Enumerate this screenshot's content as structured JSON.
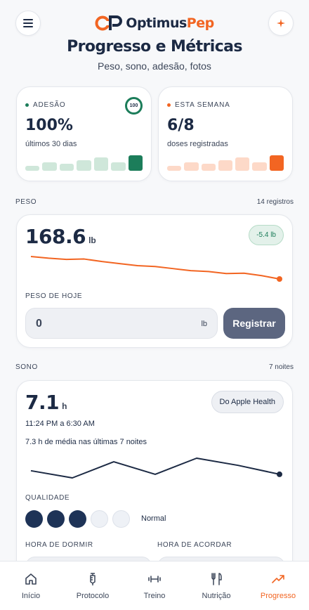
{
  "colors": {
    "accent": "#f26522",
    "navy": "#1c2a44",
    "green": "#1c7d5a"
  },
  "header": {
    "menu_icon": "hamburger-menu-icon",
    "logo_part1": "Optimus",
    "logo_part2": "Pep",
    "sparkle_icon": "sparkle-icon",
    "title": "Progresso e Métricas",
    "subtitle": "Peso, sono, adesão, fotos"
  },
  "adesao": {
    "label": "ADESÃO",
    "value": "100%",
    "sub": "últimos 30 dias",
    "badge": "100",
    "bars": [
      0.3,
      0.55,
      0.45,
      0.7,
      0.85,
      0.55,
      1.0
    ]
  },
  "semana": {
    "label": "ESTA SEMANA",
    "value": "6/8",
    "sub": "doses registradas",
    "bars": [
      0.3,
      0.55,
      0.45,
      0.7,
      0.85,
      0.55,
      1.0
    ]
  },
  "peso": {
    "section_label": "PESO",
    "count": "14 registros",
    "value": "168.6",
    "unit": "lb",
    "delta": "-5.4 lb",
    "trend": [
      174.0,
      173.6,
      173.3,
      173.4,
      172.8,
      172.3,
      171.8,
      171.6,
      171.1,
      170.6,
      170.4,
      169.9,
      170.0,
      169.4,
      168.6
    ],
    "today_label": "PESO DE HOJE",
    "input_value": "0",
    "input_unit": "lb",
    "register_button": "Registrar"
  },
  "sono": {
    "section_label": "SONO",
    "count": "7 noites",
    "value": "7.1",
    "unit": "h",
    "source": "Do Apple Health",
    "time_range": "11:24 PM a 6:30 AM",
    "average": "7.3 h de média nas últimas 7 noites",
    "trend": [
      7.3,
      6.9,
      7.8,
      7.1,
      8.0,
      7.6,
      7.1
    ],
    "quality_label": "QUALIDADE",
    "quality_level": 3,
    "quality_max": 5,
    "quality_text": "Normal",
    "bedtime_label": "HORA DE DORMIR",
    "wake_label": "HORA DE ACORDAR"
  },
  "tabs": [
    {
      "label": "Início",
      "icon": "home-icon"
    },
    {
      "label": "Protocolo",
      "icon": "syringe-icon"
    },
    {
      "label": "Treino",
      "icon": "dumbbell-icon"
    },
    {
      "label": "Nutrição",
      "icon": "fork-knife-icon"
    },
    {
      "label": "Progresso",
      "icon": "trending-up-icon",
      "active": true
    }
  ]
}
